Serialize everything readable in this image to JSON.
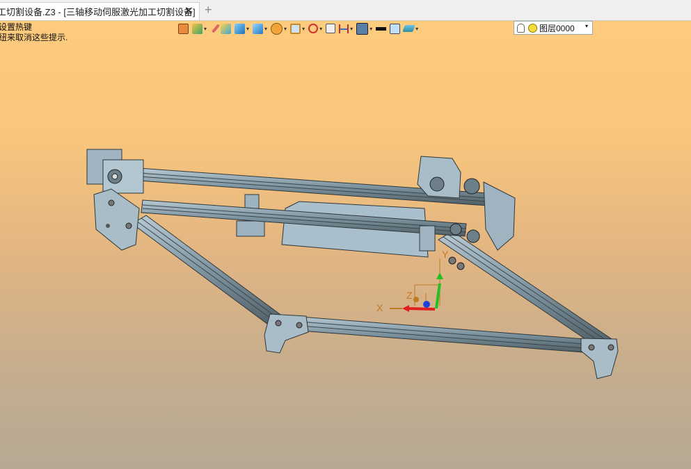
{
  "tab": {
    "title": "工切割设备.Z3 - [三轴移动伺服激光加工切割设备]",
    "close": "✕",
    "new": "+"
  },
  "hint": {
    "line1": "设置热键",
    "line2": "纽来取消这些提示."
  },
  "toolbar": {
    "icons": [
      "import-icon",
      "paint-icon",
      "pencil-icon",
      "shaded-box-icon",
      "cube-icon",
      "view-cube-icon",
      "section-icon",
      "frame-icon",
      "target-icon",
      "square-icon",
      "dimension-icon",
      "display-icon",
      "line-weight-icon",
      "fill-color-icon",
      "layer-stack-icon"
    ],
    "layer": {
      "label": "图层0000",
      "arrow": "▾"
    }
  },
  "triad": {
    "x": "X",
    "y": "Y",
    "z": "Z"
  },
  "colors": {
    "axis_x": "#e02020",
    "axis_y": "#20c020",
    "axis_z": "#2040e0",
    "triad_label": "#c07a20",
    "frame_metal": "#8aa1ad",
    "frame_dark": "#4e5c63"
  }
}
